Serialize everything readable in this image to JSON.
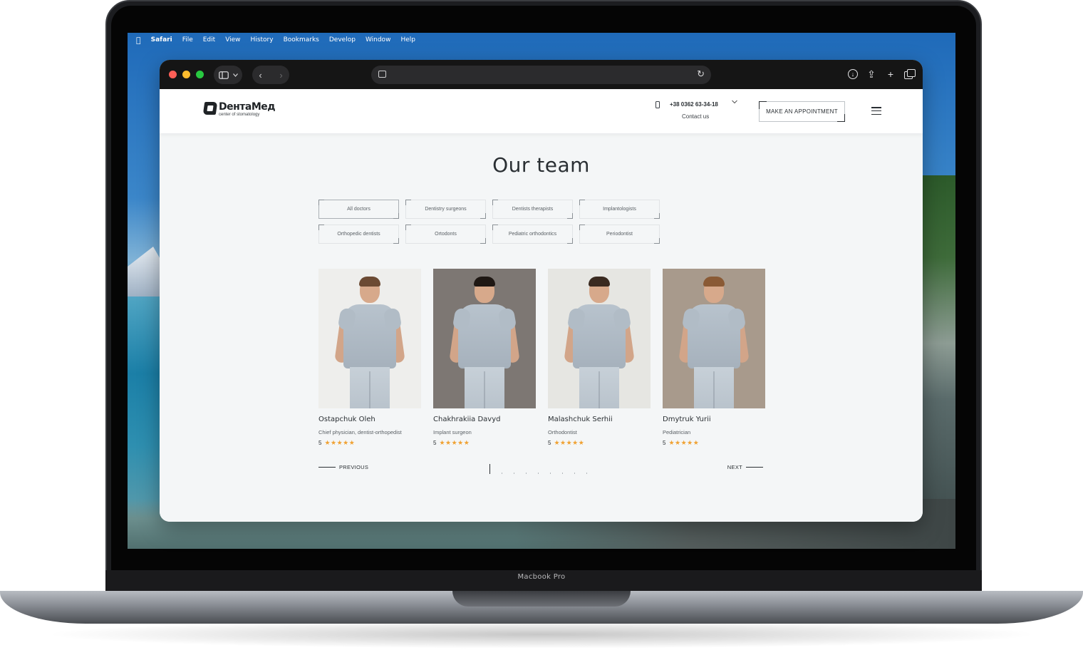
{
  "device": {
    "label": "Macbook Pro"
  },
  "menubar": {
    "apple_icon": "",
    "items": [
      "Safari",
      "File",
      "Edit",
      "View",
      "History",
      "Bookmarks",
      "Develop",
      "Window",
      "Help"
    ]
  },
  "browser": {
    "icons": {
      "sidebar": "sidebar-icon",
      "back": "‹",
      "forward": "›",
      "reload": "↻",
      "share": "⇪",
      "new_tab": "+",
      "download": "↓"
    },
    "address": ""
  },
  "site": {
    "logo": {
      "name": "DентаMед",
      "subtitle": "center of stomatology"
    },
    "phone": "+38 0362 63-34-18",
    "contact_label": "Contact us",
    "appointment_label": "MAKE AN APPOINTMENT",
    "section_title": "Our team",
    "filters": [
      {
        "label": "All doctors",
        "active": true
      },
      {
        "label": "Dentistry surgeons"
      },
      {
        "label": "Dentists therapists"
      },
      {
        "label": "Implantologists"
      },
      {
        "label": "Orthopedic dentists"
      },
      {
        "label": "Ortodonts"
      },
      {
        "label": "Pediatric orthodontics"
      },
      {
        "label": "Periodontist"
      }
    ],
    "doctors": [
      {
        "name": "Ostapchuk Oleh",
        "role": "Chief physician, dentist-orthopedist",
        "rating": "5",
        "stars": "★★★★★",
        "bg": "#eeeeec",
        "hair": "#6b4a33"
      },
      {
        "name": "Chakhrakiia Davyd",
        "role": "Implant surgeon",
        "rating": "5",
        "stars": "★★★★★",
        "bg": "#7d7773",
        "hair": "#1f1814"
      },
      {
        "name": "Malashchuk Serhii",
        "role": "Orthodontist",
        "rating": "5",
        "stars": "★★★★★",
        "bg": "#e6e6e2",
        "hair": "#3a2a20"
      },
      {
        "name": "Dmytruk Yurii",
        "role": "Pediatrician",
        "rating": "5",
        "stars": "★★★★★",
        "bg": "#a89a8c",
        "hair": "#8a5a35"
      }
    ],
    "pager": {
      "prev": "PREVIOUS",
      "next": "NEXT",
      "pages": 9,
      "current": 1
    }
  }
}
